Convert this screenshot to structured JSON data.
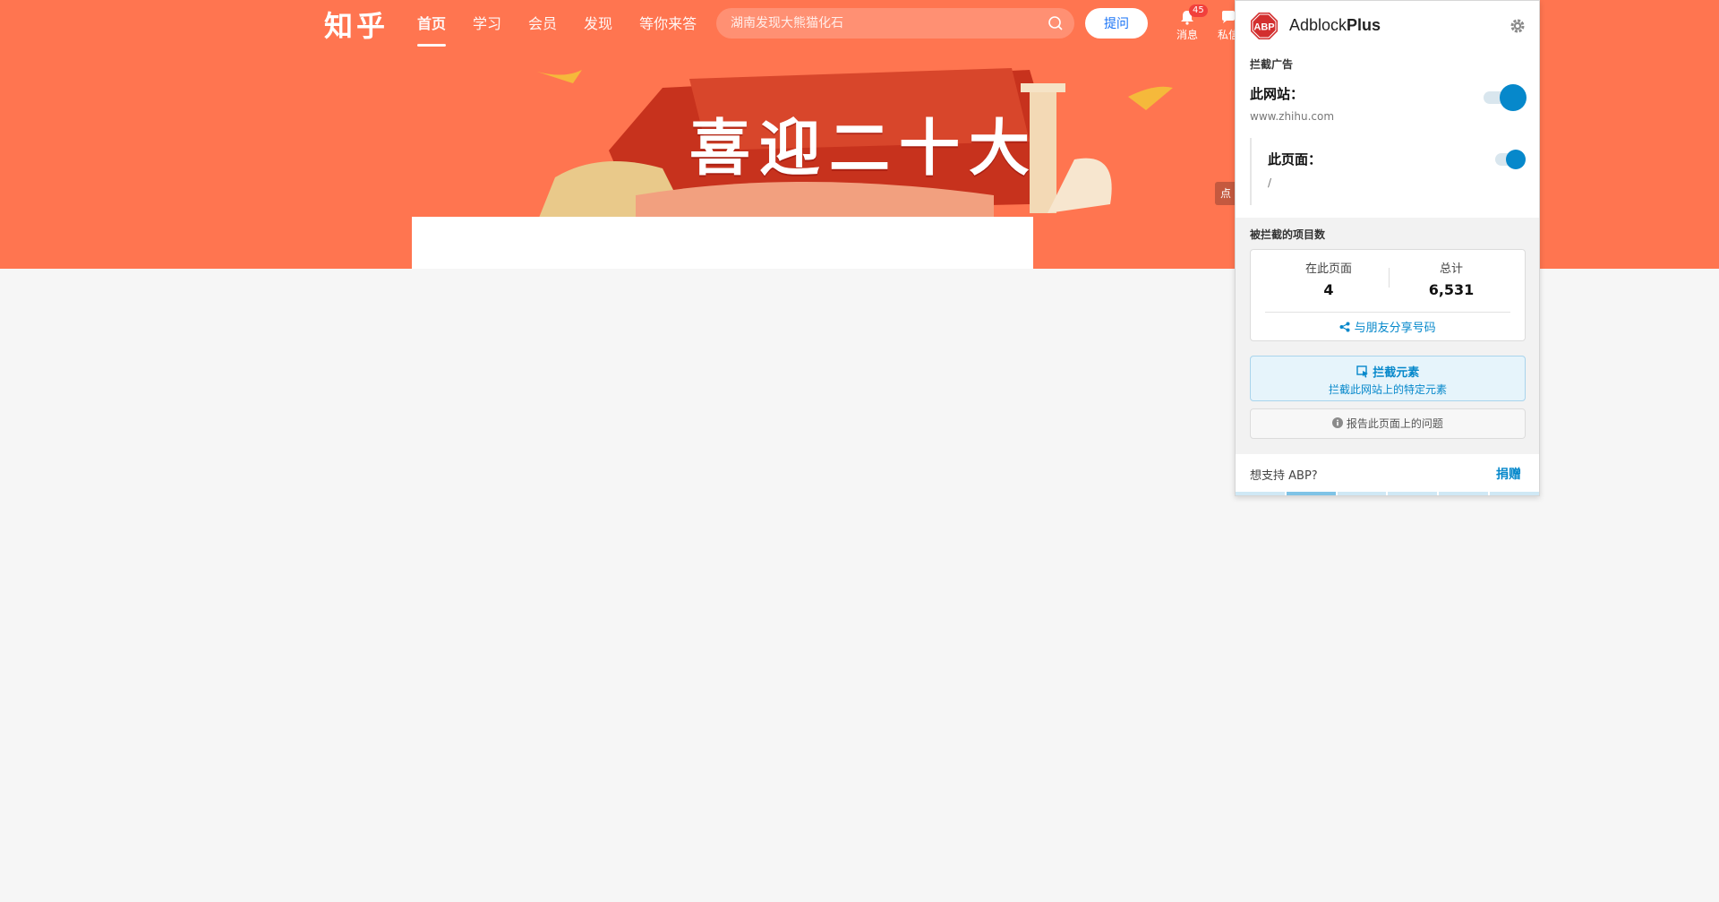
{
  "zhihu": {
    "logo": "知乎",
    "nav": [
      "首页",
      "学习",
      "会员",
      "发现",
      "等你来答"
    ],
    "search_placeholder": "湖南发现大熊猫化石",
    "ask_button": "提问",
    "messages_label": "消息",
    "messages_badge": "45",
    "private_label": "私信",
    "banner_title": "喜迎二十大",
    "side_tab": "点"
  },
  "abp": {
    "brand_regular": "Adblock",
    "brand_bold": "Plus",
    "logo_text": "ABP",
    "section_block_ads": "拦截广告",
    "site_label": "此网站：",
    "site_domain": "www.zhihu.com",
    "page_label": "此页面：",
    "page_path": "/",
    "section_blocked_count": "被拦截的项目数",
    "on_this_page_label": "在此页面",
    "on_this_page_value": "4",
    "total_label": "总计",
    "total_value": "6,531",
    "share_link": "与朋友分享号码",
    "block_element_title": "拦截元素",
    "block_element_sub": "拦截此网站上的特定元素",
    "report_issue": "报告此页面上的问题",
    "support_text": "想支持 ABP?",
    "donate": "捐赠",
    "accent_color": "#0688cb",
    "site_toggle_on": true,
    "page_toggle_on": true
  }
}
